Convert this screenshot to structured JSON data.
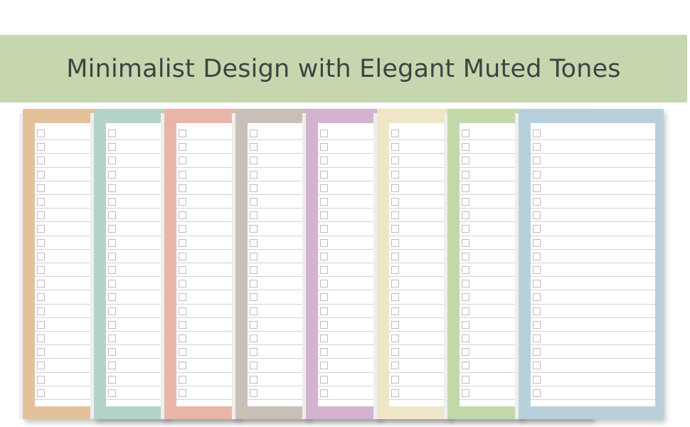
{
  "banner": {
    "title": "Minimalist Design with Elegant Muted Tones",
    "background": "#c6d7b0"
  },
  "pads": [
    {
      "color": "#e3c29b"
    },
    {
      "color": "#b3d3c9"
    },
    {
      "color": "#e9b5a6"
    },
    {
      "color": "#c8c0b6"
    },
    {
      "color": "#d3b3d0"
    },
    {
      "color": "#efe6c8"
    },
    {
      "color": "#c3d8a9"
    },
    {
      "color": "#b8d0db"
    }
  ],
  "rows_per_sheet": 20
}
